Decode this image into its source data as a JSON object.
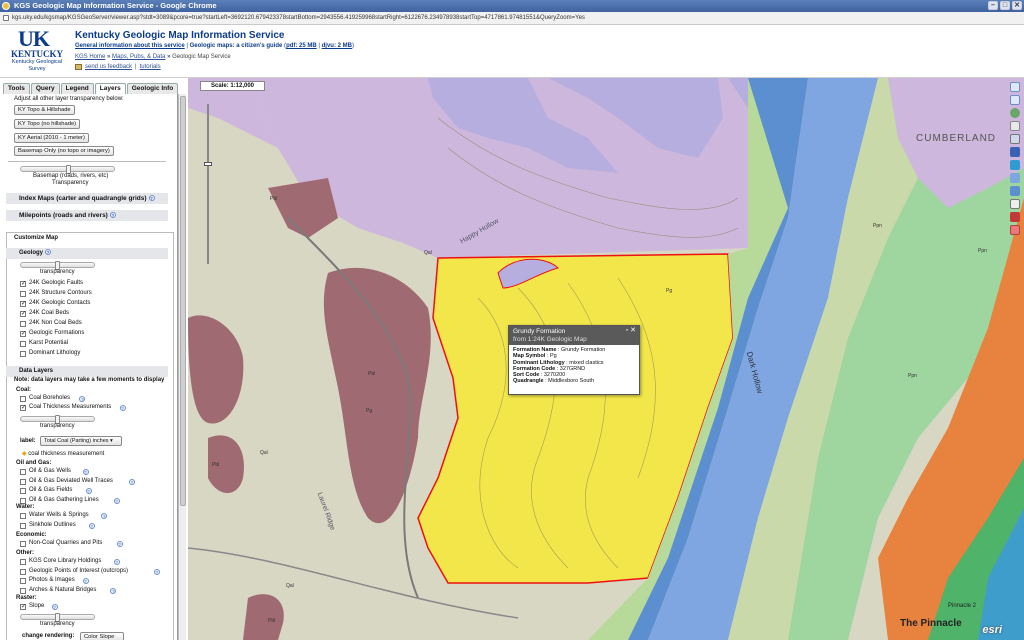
{
  "window": {
    "title": "KGS Geologic Map Information Service - Google Chrome",
    "url": "kgs.uky.edu/kgsmap/KGSGeoServer/viewer.asp?stdt=3089&pcore=true?startLeft=3692120.679423378startBottom=2943556.419259968startRight=6122676.234978938startTop=4717861.97481551&QueryZoom=Yes",
    "buttons": [
      "–",
      "□",
      "✕"
    ]
  },
  "header": {
    "logo_uk": "UK",
    "logo_university": "KENTUCKY",
    "logo_kgs": "Kentucky Geological Survey",
    "title": "Kentucky Geologic Map Information Service",
    "link_general": "General information about this service",
    "sep": "|",
    "text_guide": "Geologic maps: a citizen's guide",
    "link_pdf": "pdf: 25 MB",
    "link_djvu": "djvu: 2 MB",
    "breadcrumb": [
      "KGS Home",
      "Maps, Pubs, & Data",
      "Geologic Map Service"
    ],
    "breadcrumb_sep": "»",
    "link_feedback": "send us feedback",
    "link_tutorials": "tutorials"
  },
  "tabs": [
    "Tools",
    "Query",
    "Legend",
    "Layers",
    "Geologic Info"
  ],
  "panel": {
    "adjust_text": "Adjust all other layer transparency below:",
    "base_buttons": [
      "KY Topo & Hillshade",
      "KY Topo (no hillshade)",
      "KY Aerial (2010 - 1 meter)",
      "Basemap Only (no topo or imagery)"
    ],
    "basemap_label": "Basemap (roads, rivers, etc)",
    "transparency": "Transparency",
    "index_maps": "Index Maps (carter and quadrangle grids)",
    "milepoints": "Milepoints (roads and rivers)",
    "customize": "Customize Map",
    "geology": "Geology",
    "transparency_lc": "transparency",
    "geo_layers": [
      {
        "label": "24K Geologic Faults",
        "checked": true
      },
      {
        "label": "24K Structure Contours",
        "checked": false
      },
      {
        "label": "24K Geologic Contacts",
        "checked": true
      },
      {
        "label": "24K Coal Beds",
        "checked": true
      },
      {
        "label": "24K Non Coal Beds",
        "checked": false
      },
      {
        "label": "Geologic Formations",
        "checked": true
      },
      {
        "label": "Karst Potential",
        "checked": false
      },
      {
        "label": "Dominant Lithology",
        "checked": false
      }
    ],
    "data_layers": "Data Layers",
    "note": "Note: data layers may take a few moments to display",
    "coal": "Coal:",
    "coal_layers": [
      {
        "label": "Coal Boreholes",
        "checked": false
      },
      {
        "label": "Coal Thickness Measurements",
        "checked": true
      }
    ],
    "label_text": "label:",
    "label_select": "Total Coal (Parting) inches",
    "coal_legend": "coal thickness measurement",
    "oil": "Oil and Gas:",
    "oil_layers": [
      "Oil & Gas Wells",
      "Oil & Gas Deviated Well Traces",
      "Oil & Gas Fields",
      "Oil & Gas Gathering Lines"
    ],
    "water": "Water:",
    "water_layers": [
      "Water Wells & Springs",
      "Sinkhole Outlines"
    ],
    "economic": "Economic:",
    "economic_layers": [
      "Non-Coal Quarries and Pits"
    ],
    "other": "Other:",
    "other_layers": [
      "KGS Core Library Holdings",
      "Geologic Points of Interest (outcrops)",
      "Photos & Images",
      "Arches & Natural Bridges"
    ],
    "raster": "Raster:",
    "raster_layers": [
      {
        "label": "Slope",
        "checked": true
      }
    ],
    "change_rendering": "change rendering:",
    "rendering_select": "Color Slope"
  },
  "map": {
    "scale": "Scale: 1:12,000",
    "esri": "esri",
    "popup": {
      "title": "Grundy Formation",
      "subtitle": "from 1:24K Geologic Map",
      "rows": [
        {
          "k": "Formation Name",
          "v": "Grundy Formation"
        },
        {
          "k": "Map Symbol",
          "v": "Pg"
        },
        {
          "k": "Dominant Lithology",
          "v": "mixed clastics"
        },
        {
          "k": "Formation Code",
          "v": "327GRND"
        },
        {
          "k": "Sort Code",
          "v": "3270200"
        },
        {
          "k": "Quadrangle",
          "v": "Middlesboro South"
        }
      ]
    },
    "labels": [
      "Pg",
      "Pg",
      "Pbl",
      "Pbl",
      "Pbl",
      "Qal",
      "Qal",
      "Qal",
      "Pbl",
      "Ppn",
      "Ppn",
      "Ppn",
      "CUMBERLAND",
      "The Pinnacle",
      "Pinnacle 2",
      "Dark Hollow",
      "Happy Hollow",
      "Laurel Ridge"
    ]
  },
  "colors": {
    "yellow": "#f2e64a",
    "purple": "#c6a9d6",
    "lavender": "#b4a7e0",
    "maroon": "#a06a72",
    "blue": "#5b8fd0",
    "green": "#7fc97f",
    "orange": "#e8823f",
    "tan": "#e9e2c2"
  }
}
